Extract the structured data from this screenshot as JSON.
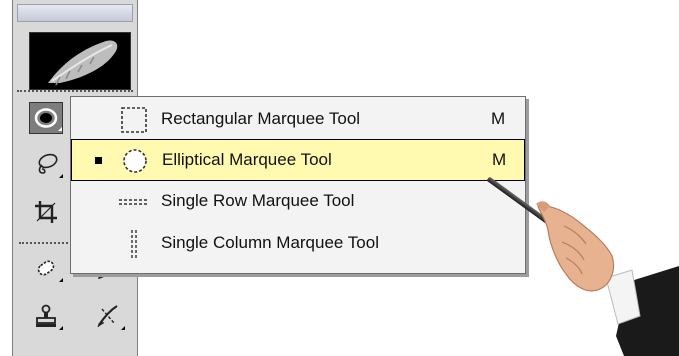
{
  "tools": [
    {
      "name": "elliptical-marquee-tool",
      "icon": "elliptical-marquee-icon",
      "selected": true
    },
    {
      "name": "lasso-tool",
      "icon": "lasso-icon",
      "selected": false
    },
    {
      "name": "crop-tool",
      "icon": "crop-icon",
      "selected": false
    },
    {
      "name": "healing-brush-tool",
      "icon": "healing-brush-icon",
      "selected": false
    },
    {
      "name": "brush-tool",
      "icon": "brush-icon",
      "selected": false
    },
    {
      "name": "clone-stamp-tool",
      "icon": "clone-stamp-icon",
      "selected": false
    },
    {
      "name": "history-brush-tool",
      "icon": "history-brush-icon",
      "selected": false
    }
  ],
  "flyout": {
    "items": [
      {
        "label": "Rectangular Marquee Tool",
        "shortcut": "M",
        "icon": "rectangular-marquee-icon",
        "active": false
      },
      {
        "label": "Elliptical Marquee Tool",
        "shortcut": "M",
        "icon": "elliptical-marquee-icon",
        "active": true
      },
      {
        "label": "Single Row Marquee Tool",
        "shortcut": "",
        "icon": "single-row-marquee-icon",
        "active": false
      },
      {
        "label": "Single Column Marquee Tool",
        "shortcut": "",
        "icon": "single-column-marquee-icon",
        "active": false
      }
    ]
  },
  "colors": {
    "highlight": "#fffab0",
    "menu_background": "#f3f3f3",
    "toolbox_background": "#d9d9d9"
  }
}
